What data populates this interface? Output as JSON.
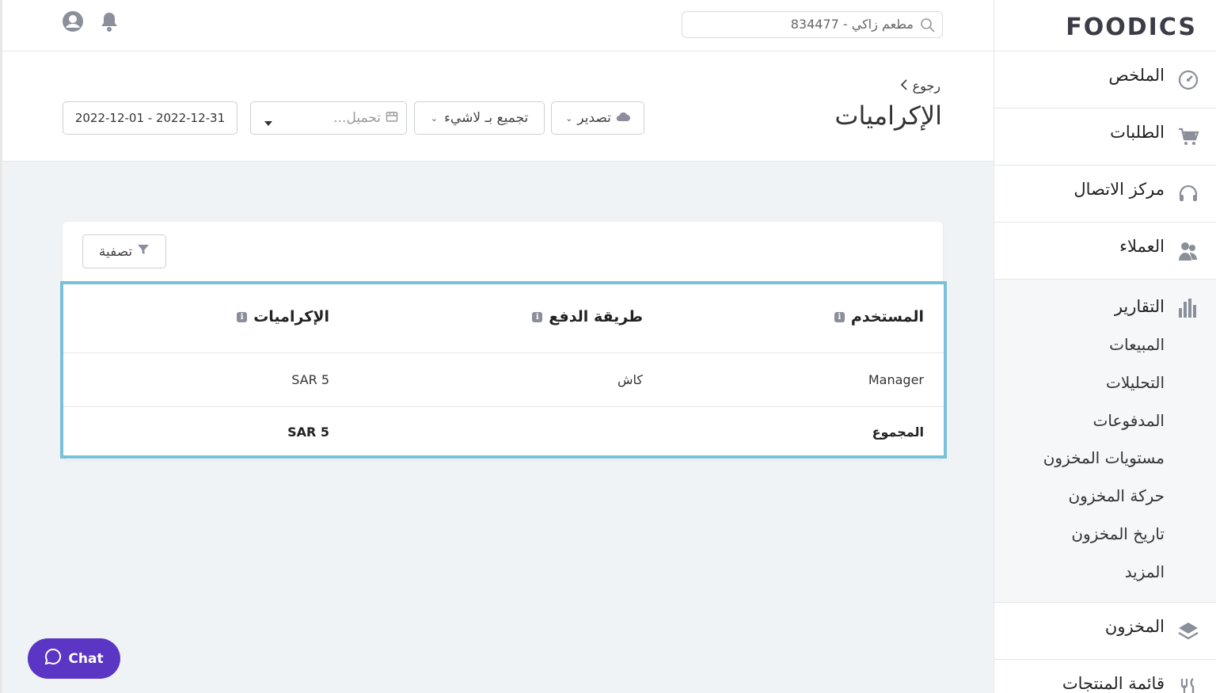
{
  "topbar": {
    "search_value": "مطعم زاكي - 834477"
  },
  "header": {
    "back_label": "رجوع",
    "title": "الإكراميات",
    "export_label": "تصدير",
    "group_label": "تجميع بـ لاشيء",
    "branch_placeholder": "تحميل...",
    "date_range": "2022-12-01 - 2022-12-31"
  },
  "card": {
    "filter_label": "تصفية"
  },
  "table": {
    "headers": [
      "المستخدم",
      "طريقة الدفع",
      "الإكراميات"
    ],
    "rows": [
      {
        "user": "Manager",
        "payment": "كاش",
        "tips": "SAR 5"
      }
    ],
    "total": {
      "label": "المجموع",
      "tips": "SAR 5"
    }
  },
  "chat": {
    "label": "Chat"
  },
  "sidebar": {
    "logo": "FOODICS",
    "items": [
      {
        "label": "الملخص"
      },
      {
        "label": "الطلبات"
      },
      {
        "label": "مركز الاتصال"
      },
      {
        "label": "العملاء"
      }
    ],
    "reports": {
      "label": "التقارير",
      "subitems": [
        "المبيعات",
        "التحليلات",
        "المدفوعات",
        "مستويات المخزون",
        "حركة المخزون",
        "تاريخ المخزون",
        "المزيد"
      ]
    },
    "inventory_label": "المخزون",
    "menu_label": "قائمة المنتجات"
  },
  "colors": {
    "accent_border": "#79c1d9",
    "chat_purple": "#5b35c4"
  }
}
